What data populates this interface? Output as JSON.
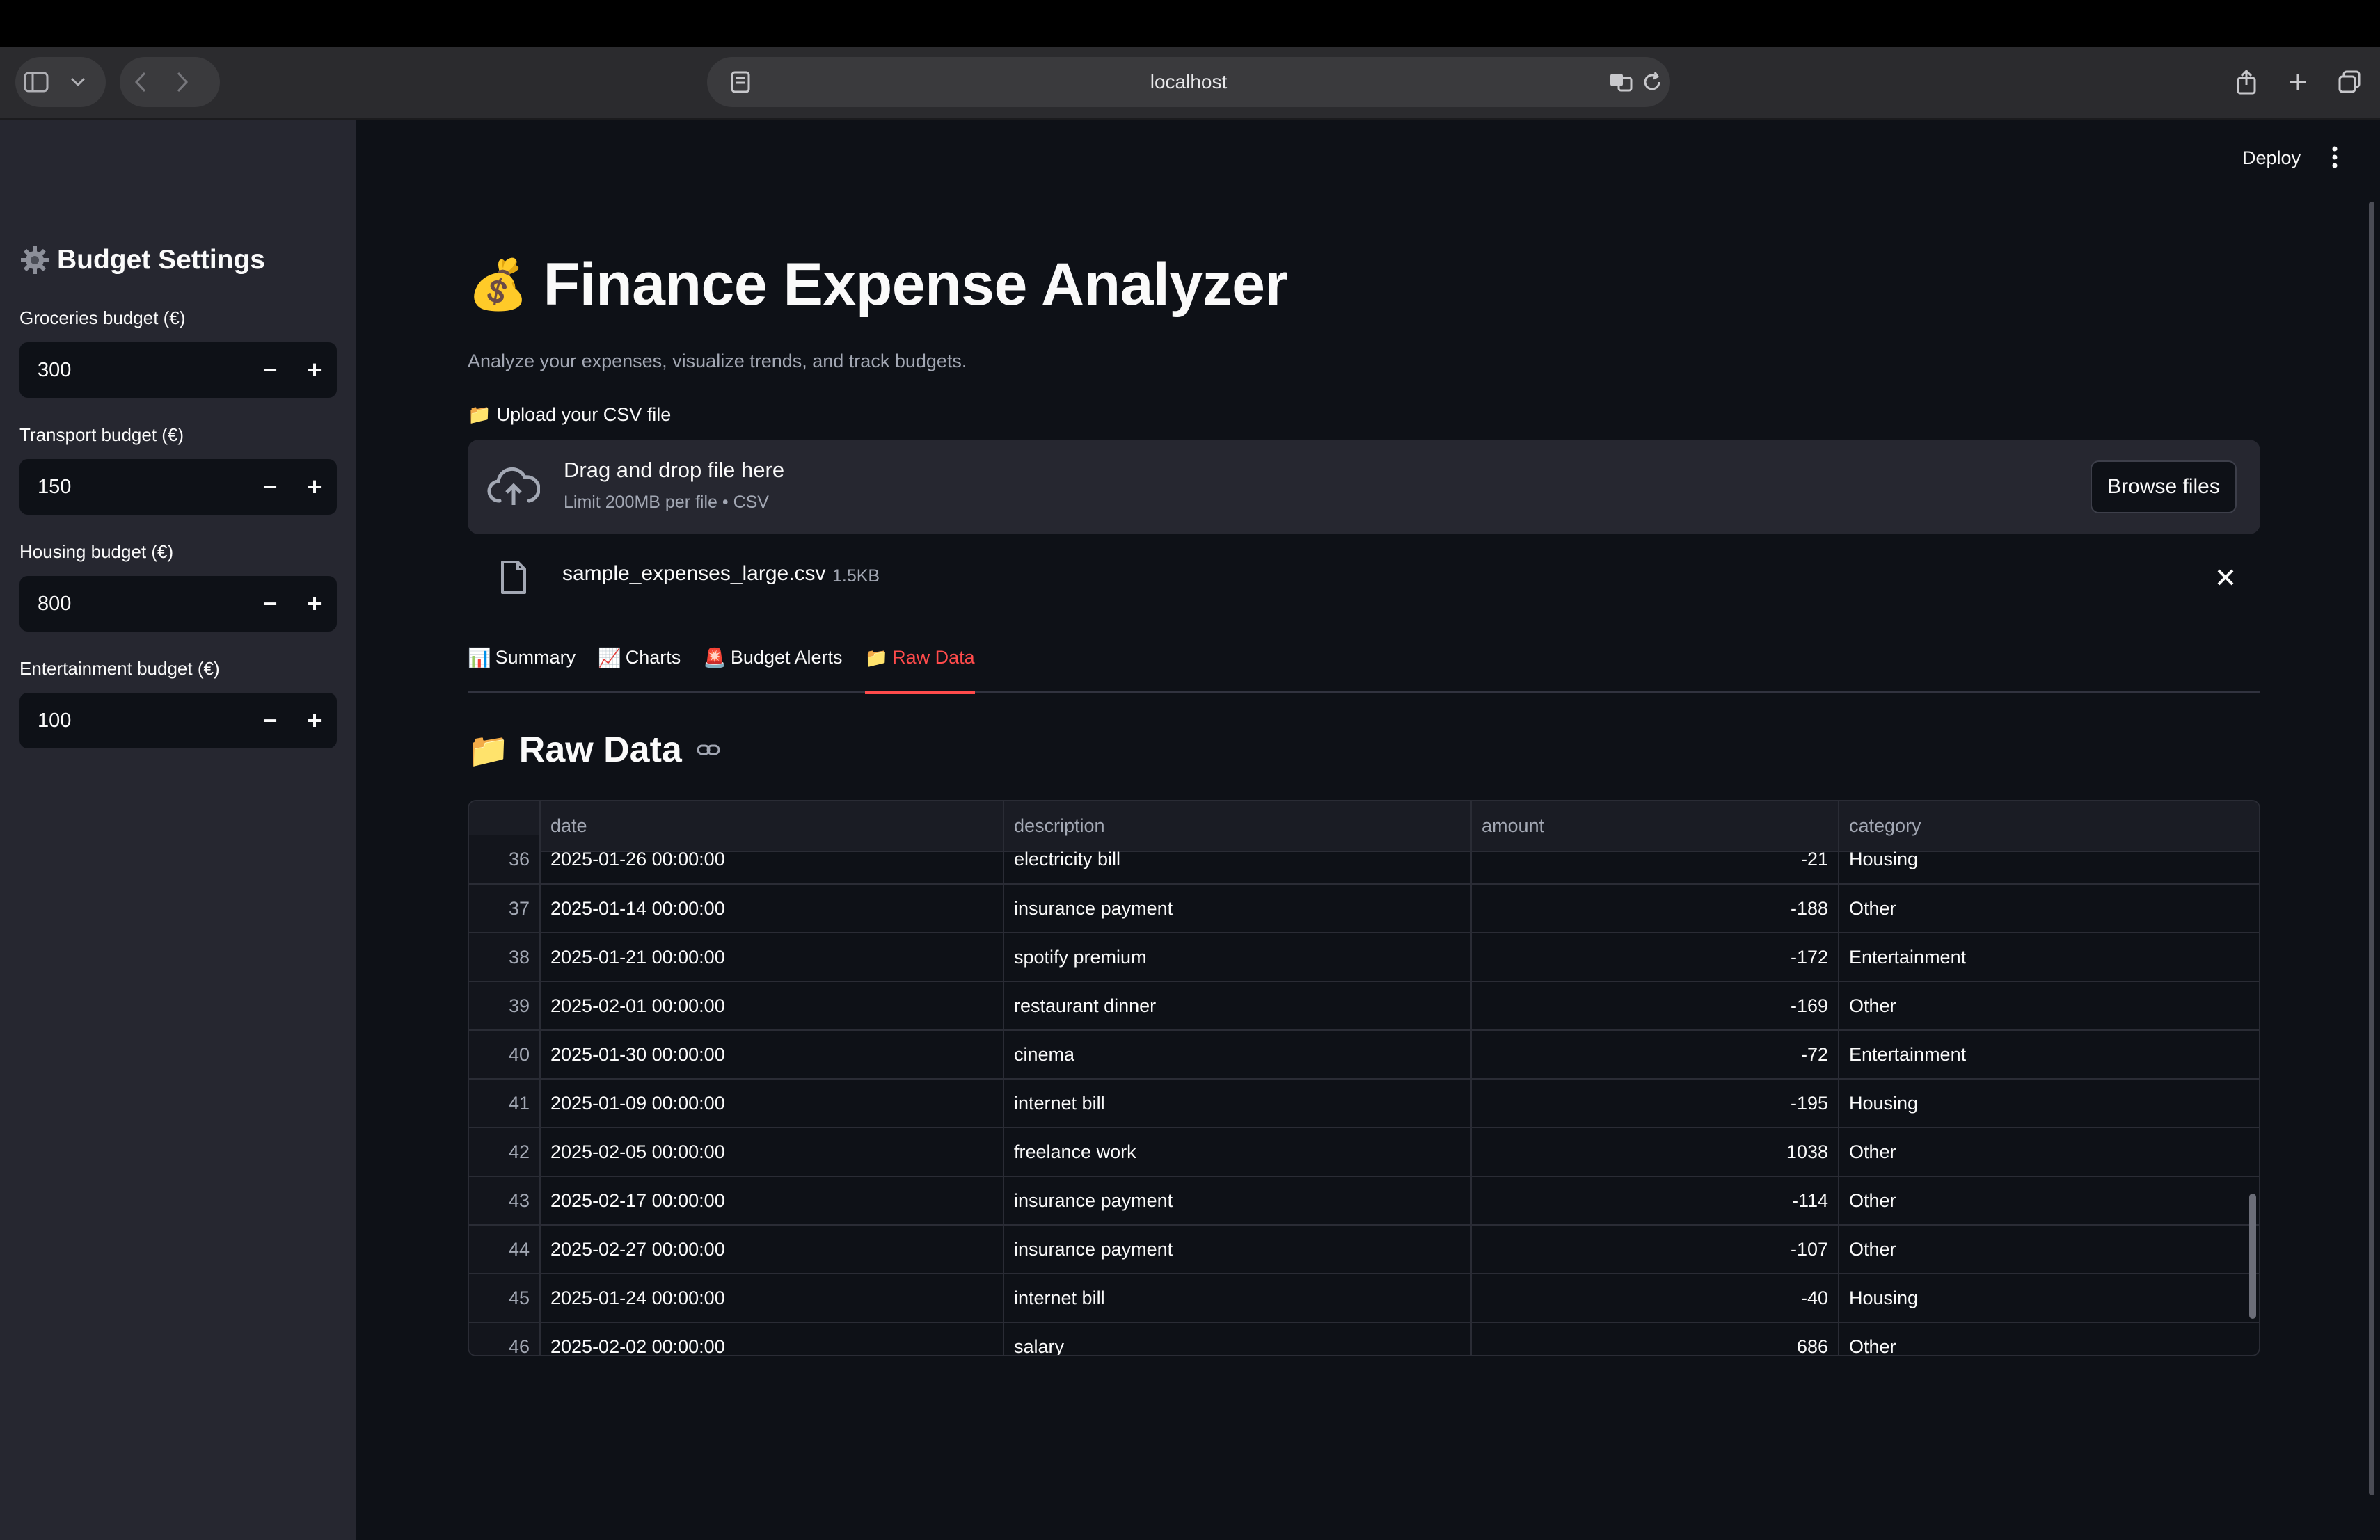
{
  "browser": {
    "url": "localhost"
  },
  "header": {
    "deploy_label": "Deploy"
  },
  "sidebar": {
    "title": "Budget Settings",
    "title_icon": "gear-icon",
    "fields": [
      {
        "label": "Groceries budget (€)",
        "value": "300"
      },
      {
        "label": "Transport budget (€)",
        "value": "150"
      },
      {
        "label": "Housing budget (€)",
        "value": "800"
      },
      {
        "label": "Entertainment budget (€)",
        "value": "100"
      }
    ],
    "decrement": "−",
    "increment": "+"
  },
  "main": {
    "title_icon": "💰",
    "title": "Finance Expense Analyzer",
    "caption": "Analyze your expenses, visualize trends, and track budgets.",
    "upload_icon": "📁",
    "upload_label": "Upload your CSV file",
    "dropzone": {
      "title": "Drag and drop file here",
      "subtitle": "Limit 200MB per file • CSV",
      "browse": "Browse files"
    },
    "file": {
      "name": "sample_expenses_large.csv",
      "size": "1.5KB"
    },
    "tabs": [
      {
        "icon": "📊",
        "label": "Summary"
      },
      {
        "icon": "📈",
        "label": "Charts"
      },
      {
        "icon": "🚨",
        "label": "Budget Alerts"
      },
      {
        "icon": "📁",
        "label": "Raw Data"
      }
    ],
    "active_tab": "Raw Data",
    "section_icon": "📁",
    "section_title": "Raw Data"
  },
  "table": {
    "columns": [
      "",
      "date",
      "description",
      "amount",
      "category"
    ],
    "rows": [
      [
        "36",
        "2025-01-26 00:00:00",
        "electricity bill",
        "-21",
        "Housing"
      ],
      [
        "37",
        "2025-01-14 00:00:00",
        "insurance payment",
        "-188",
        "Other"
      ],
      [
        "38",
        "2025-01-21 00:00:00",
        "spotify premium",
        "-172",
        "Entertainment"
      ],
      [
        "39",
        "2025-02-01 00:00:00",
        "restaurant dinner",
        "-169",
        "Other"
      ],
      [
        "40",
        "2025-01-30 00:00:00",
        "cinema",
        "-72",
        "Entertainment"
      ],
      [
        "41",
        "2025-01-09 00:00:00",
        "internet bill",
        "-195",
        "Housing"
      ],
      [
        "42",
        "2025-02-05 00:00:00",
        "freelance work",
        "1038",
        "Other"
      ],
      [
        "43",
        "2025-02-17 00:00:00",
        "insurance payment",
        "-114",
        "Other"
      ],
      [
        "44",
        "2025-02-27 00:00:00",
        "insurance payment",
        "-107",
        "Other"
      ],
      [
        "45",
        "2025-01-24 00:00:00",
        "internet bill",
        "-40",
        "Housing"
      ],
      [
        "46",
        "2025-02-02 00:00:00",
        "salary",
        "686",
        "Other"
      ]
    ]
  },
  "colors": {
    "accent": "#ff4b4b",
    "sidebar_bg": "#262730",
    "main_bg": "#0e1117"
  }
}
